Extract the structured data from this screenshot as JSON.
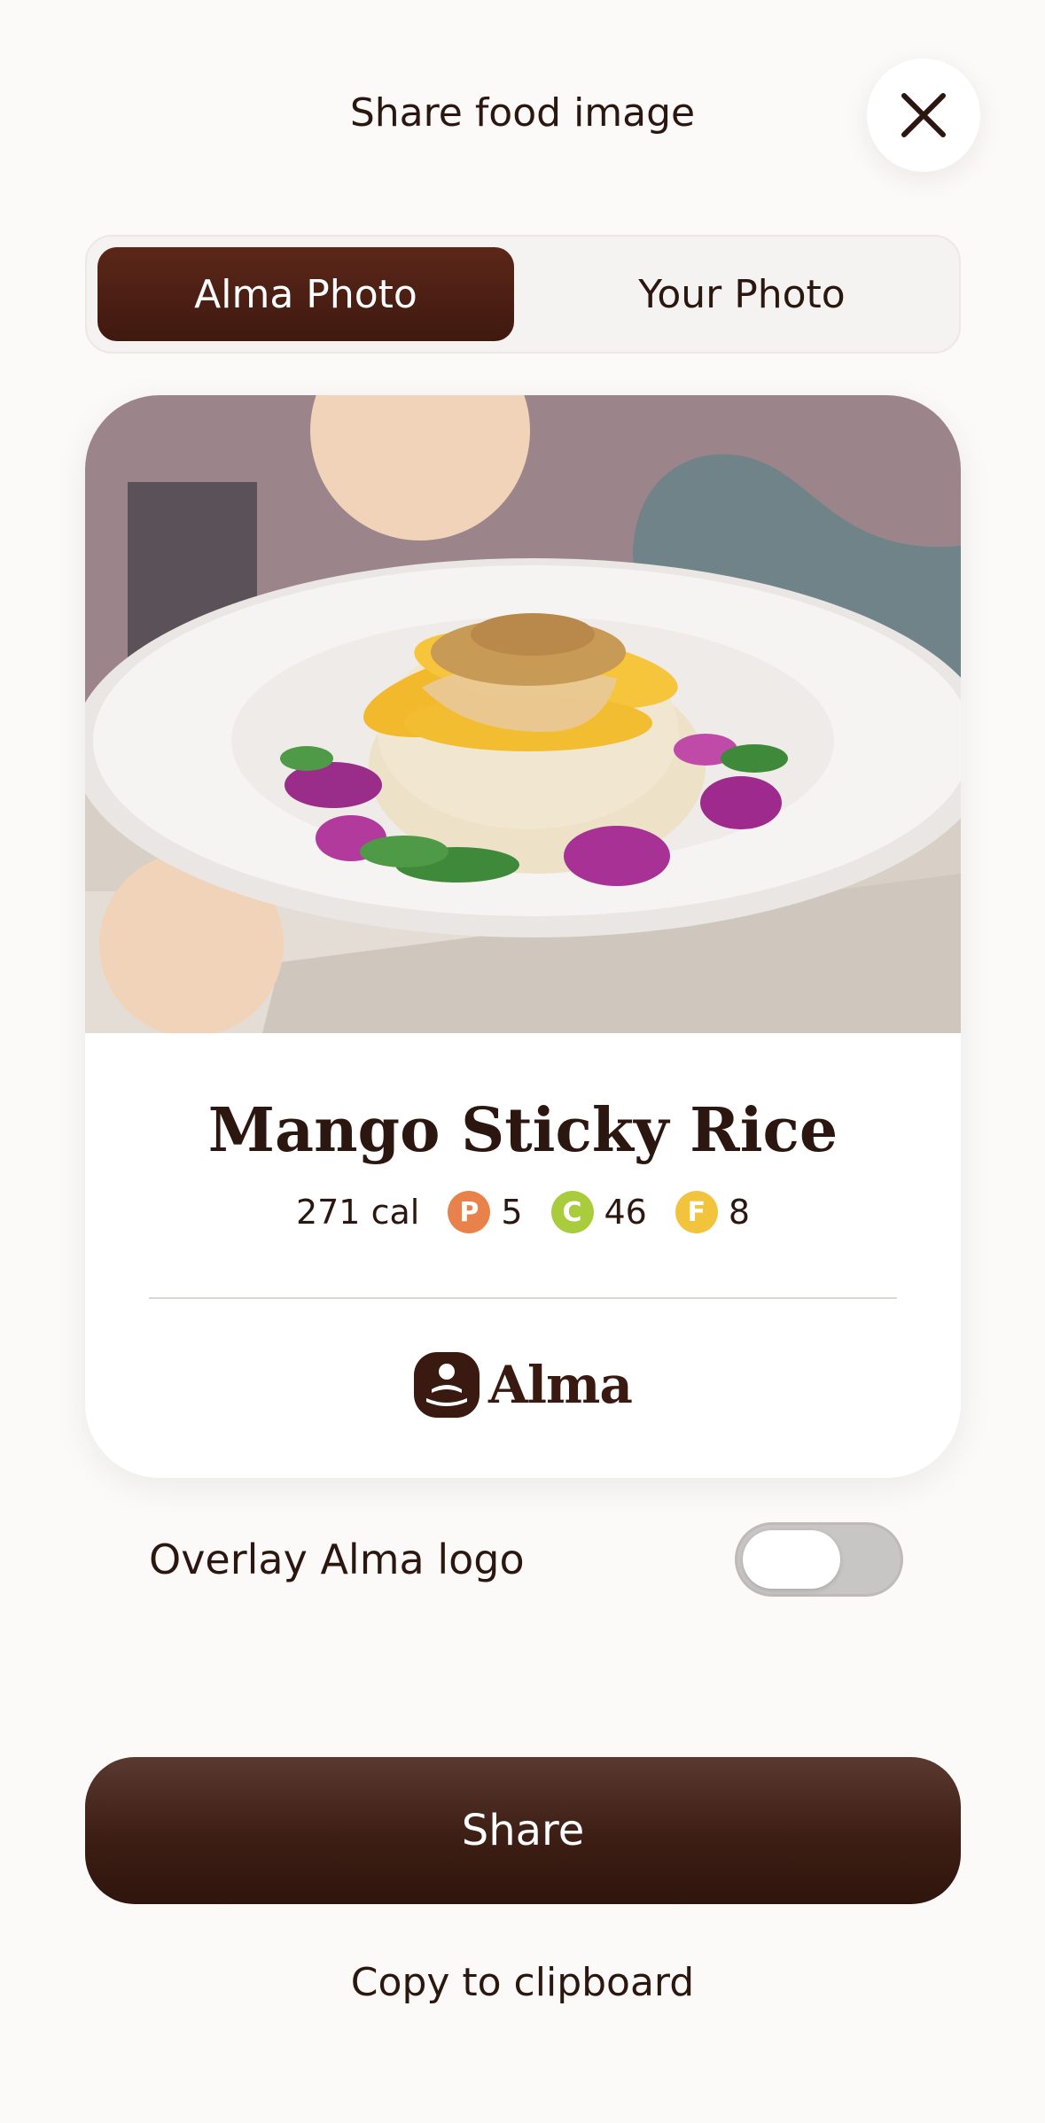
{
  "header": {
    "title": "Share food image"
  },
  "close": {
    "icon": "close-icon"
  },
  "tabs": [
    {
      "label": "Alma Photo",
      "active": true
    },
    {
      "label": "Your Photo",
      "active": false
    }
  ],
  "card": {
    "food_name": "Mango Sticky Rice",
    "calories": "271 cal",
    "macros": [
      {
        "letter": "P",
        "value": "5",
        "color": "#e8814a"
      },
      {
        "letter": "C",
        "value": "46",
        "color": "#a9cc3c"
      },
      {
        "letter": "F",
        "value": "8",
        "color": "#f2c43d"
      }
    ],
    "brand": "Alma"
  },
  "overlay": {
    "label": "Overlay Alma logo",
    "enabled": false
  },
  "actions": {
    "share_label": "Share",
    "copy_label": "Copy to clipboard"
  },
  "colors": {
    "primary": "#3f190f",
    "background": "#fbfaf9"
  }
}
